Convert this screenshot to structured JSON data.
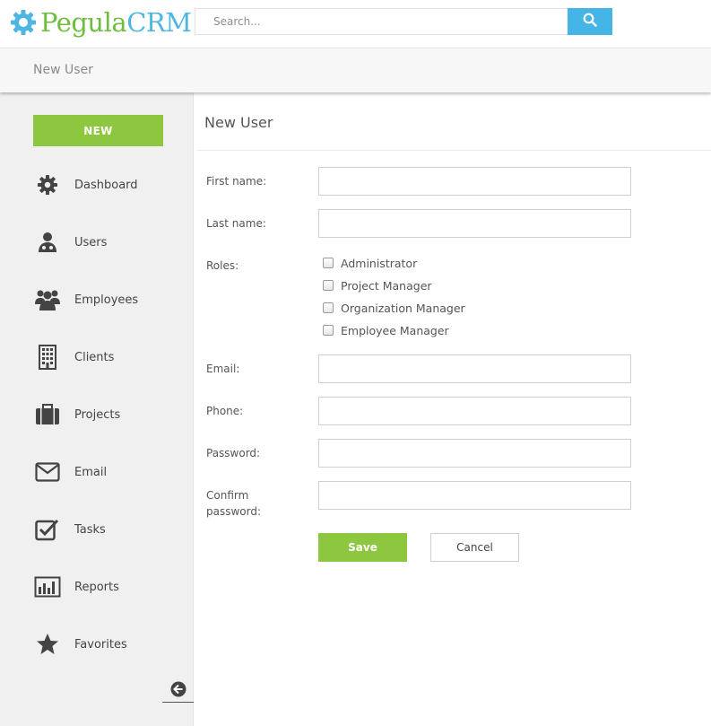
{
  "app": {
    "logo_part1": "Pegula",
    "logo_part2": "CRM"
  },
  "search": {
    "placeholder": "Search...",
    "icon": "search-icon"
  },
  "breadcrumb": {
    "current": "New User"
  },
  "sidebar": {
    "new_label": "NEW",
    "items": [
      {
        "label": "Dashboard",
        "icon": "gear-icon"
      },
      {
        "label": "Users",
        "icon": "user-icon"
      },
      {
        "label": "Employees",
        "icon": "group-icon"
      },
      {
        "label": "Clients",
        "icon": "building-icon"
      },
      {
        "label": "Projects",
        "icon": "briefcase-icon"
      },
      {
        "label": "Email",
        "icon": "envelope-icon"
      },
      {
        "label": "Tasks",
        "icon": "checkbox-icon"
      },
      {
        "label": "Reports",
        "icon": "bar-chart-icon"
      },
      {
        "label": "Favorites",
        "icon": "star-icon"
      }
    ],
    "collapse_icon": "arrow-left-circle-icon"
  },
  "form": {
    "title": "New User",
    "first_name_label": "First name:",
    "first_name_value": "",
    "last_name_label": "Last name:",
    "last_name_value": "",
    "roles_label": "Roles:",
    "roles": [
      {
        "label": "Administrator",
        "checked": false
      },
      {
        "label": "Project Manager",
        "checked": false
      },
      {
        "label": "Organization Manager",
        "checked": false
      },
      {
        "label": "Employee Manager",
        "checked": false
      }
    ],
    "email_label": "Email:",
    "email_value": "",
    "phone_label": "Phone:",
    "phone_value": "",
    "password_label": "Password:",
    "password_value": "",
    "confirm_label_line1": "Confirm",
    "confirm_label_line2": "password:",
    "confirm_value": "",
    "save_label": "Save",
    "cancel_label": "Cancel"
  },
  "colors": {
    "brand_green": "#8dc63f",
    "brand_blue": "#45b5e8",
    "logo_green": "#6cbe3c"
  }
}
